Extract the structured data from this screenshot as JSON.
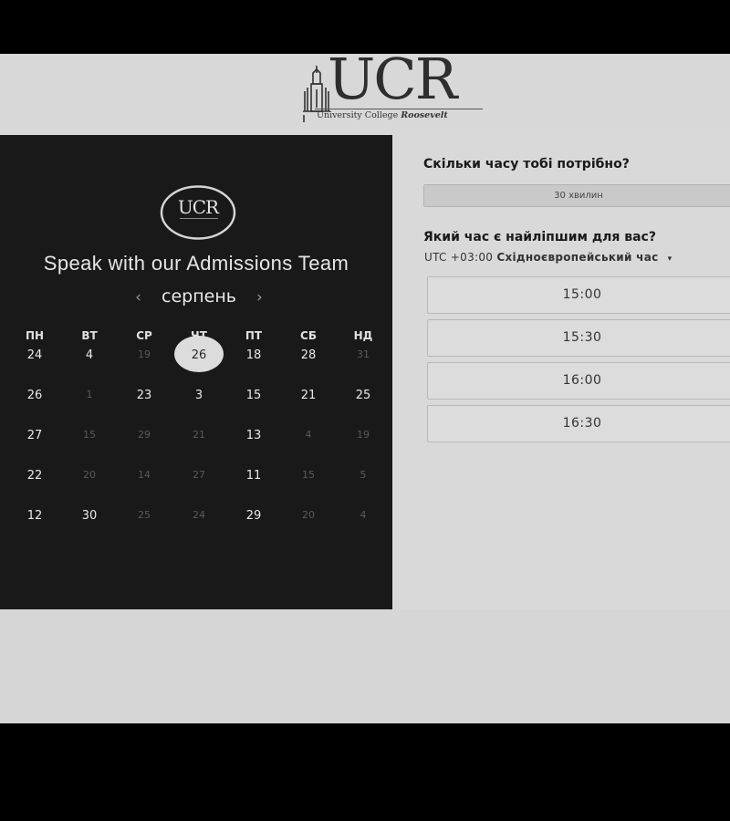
{
  "brand": {
    "logo_text": "UCR",
    "logo_subtitle_plain": "University College ",
    "logo_subtitle_italic": "Roosevelt"
  },
  "calendar_panel": {
    "badge_text": "UCR",
    "title": "Speak with our Admissions Team",
    "month": "серпень",
    "prev_icon": "‹",
    "next_icon": "›",
    "weekdays": [
      "ПН",
      "ВТ",
      "СР",
      "ЧТ",
      "ПТ",
      "СБ",
      "НД"
    ],
    "weeks": [
      [
        {
          "d": "24",
          "on": true
        },
        {
          "d": "4",
          "on": true
        },
        {
          "d": "19",
          "on": false
        },
        {
          "d": "26",
          "on": true,
          "selected": true
        },
        {
          "d": "18",
          "on": true
        },
        {
          "d": "28",
          "on": true
        },
        {
          "d": "31",
          "on": false
        }
      ],
      [
        {
          "d": "26",
          "on": true
        },
        {
          "d": "1",
          "on": false
        },
        {
          "d": "23",
          "on": true
        },
        {
          "d": "3",
          "on": true
        },
        {
          "d": "15",
          "on": true
        },
        {
          "d": "21",
          "on": true
        },
        {
          "d": "25",
          "on": true
        }
      ],
      [
        {
          "d": "27",
          "on": true
        },
        {
          "d": "15",
          "on": false
        },
        {
          "d": "29",
          "on": false
        },
        {
          "d": "21",
          "on": false
        },
        {
          "d": "13",
          "on": true
        },
        {
          "d": "4",
          "on": false
        },
        {
          "d": "19",
          "on": false
        }
      ],
      [
        {
          "d": "22",
          "on": true
        },
        {
          "d": "20",
          "on": false
        },
        {
          "d": "14",
          "on": false
        },
        {
          "d": "27",
          "on": false
        },
        {
          "d": "11",
          "on": true
        },
        {
          "d": "15",
          "on": false
        },
        {
          "d": "5",
          "on": false
        }
      ],
      [
        {
          "d": "12",
          "on": true
        },
        {
          "d": "30",
          "on": true
        },
        {
          "d": "25",
          "on": false
        },
        {
          "d": "24",
          "on": false
        },
        {
          "d": "29",
          "on": true
        },
        {
          "d": "20",
          "on": false
        },
        {
          "d": "4",
          "on": false
        }
      ]
    ]
  },
  "booking_panel": {
    "duration_question": "Скільки часу тобі потрібно?",
    "duration_option": "30 хвилин",
    "time_question": "Який час є найліпшим для вас?",
    "timezone_offset": "UTC +03:00",
    "timezone_name": "Східноєвропейський час",
    "timezone_caret": "▾",
    "slots": [
      "15:00",
      "15:30",
      "16:00",
      "16:30"
    ]
  },
  "colors": {
    "calendar_bg": "#191919",
    "page_bg": "#d6d6d6",
    "selected_day_bg": "#dcdcdc"
  }
}
